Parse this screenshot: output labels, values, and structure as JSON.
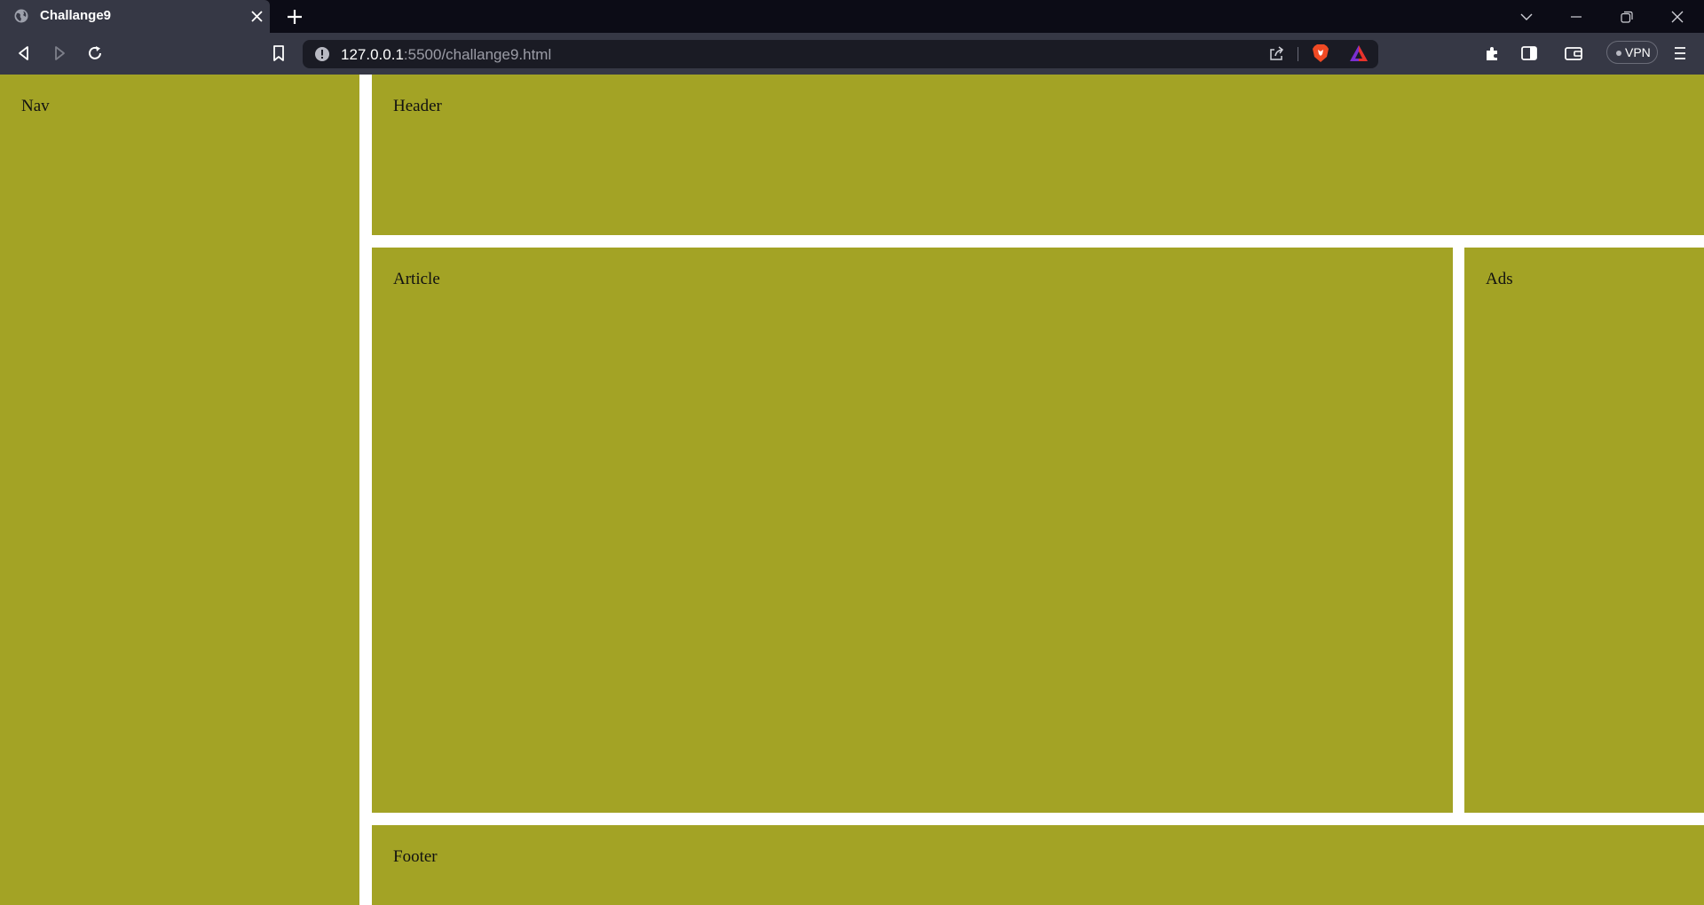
{
  "browser": {
    "tab": {
      "title": "Challange9",
      "favicon": "globe-icon"
    },
    "url": {
      "host": "127.0.0.1",
      "path": ":5500/challange9.html"
    },
    "vpn_label": "VPN"
  },
  "page": {
    "nav": "Nav",
    "header": "Header",
    "article": "Article",
    "ads": "Ads",
    "footer": "Footer",
    "box_color": "#a3a325"
  }
}
